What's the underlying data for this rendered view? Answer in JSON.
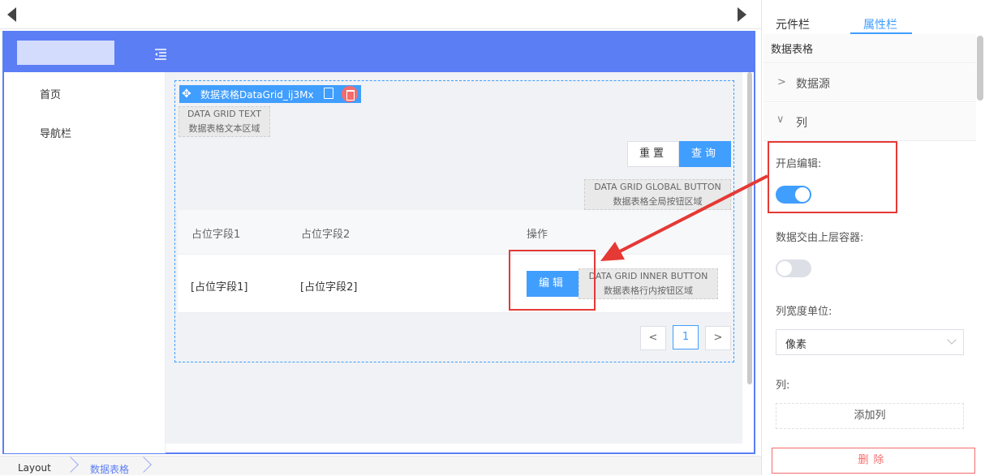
{
  "canvas": {
    "nav": [
      "首页",
      "导航栏"
    ],
    "datagrid": {
      "toolbar_title": "数据表格DataGrid_ij3Mx",
      "text_zone": [
        "DATA GRID TEXT",
        "数据表格文本区域"
      ],
      "reset_label": "重置",
      "query_label": "查询",
      "global_zone": [
        "DATA GRID GLOBAL BUTTON",
        "数据表格全局按钮区域"
      ],
      "columns": [
        "占位字段1",
        "占位字段2",
        "操作"
      ],
      "row": [
        "[占位字段1]",
        "[占位字段2]"
      ],
      "edit_label": "编辑",
      "inner_zone": [
        "DATA GRID INNER BUTTON",
        "数据表格行内按钮区域"
      ],
      "pager": {
        "prev": "<",
        "page": "1",
        "next": ">"
      }
    }
  },
  "breadcrumb": [
    "Layout",
    "数据表格"
  ],
  "panel": {
    "tabs": [
      "元件栏",
      "属性栏"
    ],
    "active_tab": "属性栏",
    "title": "数据表格",
    "sections": {
      "datasource": "数据源",
      "columns": "列"
    },
    "enable_edit_label": "开启编辑:",
    "enable_edit_on": true,
    "parent_container_label": "数据交由上层容器:",
    "parent_container_on": false,
    "width_unit_label": "列宽度单位:",
    "width_unit_value": "像素",
    "columns_label": "列:",
    "add_column_label": "添加列",
    "delete_label": "删除"
  },
  "colors": {
    "primary": "#409eff",
    "header": "#5b7ef5",
    "annotation": "#e53935"
  }
}
